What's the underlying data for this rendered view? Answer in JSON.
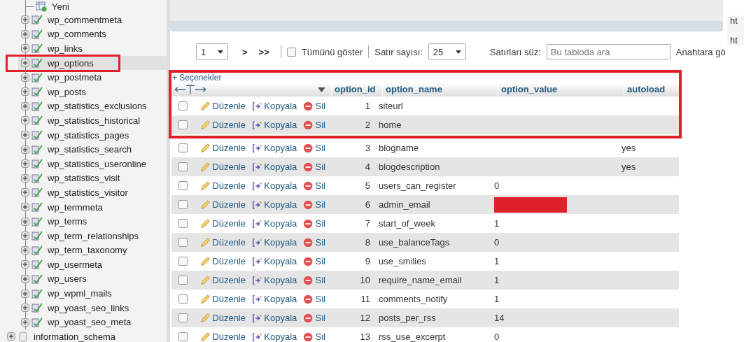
{
  "sidebar": {
    "new_item": {
      "label": "Yeni"
    },
    "items": [
      {
        "label": "wp_commentmeta",
        "selected": false,
        "framed": false
      },
      {
        "label": "wp_comments",
        "selected": false,
        "framed": false
      },
      {
        "label": "wp_links",
        "selected": false,
        "framed": false
      },
      {
        "label": "wp_options",
        "selected": true,
        "framed": true
      },
      {
        "label": "wp_postmeta",
        "selected": false,
        "framed": false
      },
      {
        "label": "wp_posts",
        "selected": false,
        "framed": false
      },
      {
        "label": "wp_statistics_exclusions",
        "selected": false,
        "framed": false
      },
      {
        "label": "wp_statistics_historical",
        "selected": false,
        "framed": false
      },
      {
        "label": "wp_statistics_pages",
        "selected": false,
        "framed": false
      },
      {
        "label": "wp_statistics_search",
        "selected": false,
        "framed": false
      },
      {
        "label": "wp_statistics_useronline",
        "selected": false,
        "framed": false
      },
      {
        "label": "wp_statistics_visit",
        "selected": false,
        "framed": false
      },
      {
        "label": "wp_statistics_visitor",
        "selected": false,
        "framed": false
      },
      {
        "label": "wp_termmeta",
        "selected": false,
        "framed": false
      },
      {
        "label": "wp_terms",
        "selected": false,
        "framed": false
      },
      {
        "label": "wp_term_relationships",
        "selected": false,
        "framed": false
      },
      {
        "label": "wp_term_taxonomy",
        "selected": false,
        "framed": false
      },
      {
        "label": "wp_usermeta",
        "selected": false,
        "framed": false
      },
      {
        "label": "wp_users",
        "selected": false,
        "framed": false
      },
      {
        "label": "wp_wpml_mails",
        "selected": false,
        "framed": false
      },
      {
        "label": "wp_yoast_seo_links",
        "selected": false,
        "framed": false
      },
      {
        "label": "wp_yoast_seo_meta",
        "selected": false,
        "framed": false
      }
    ],
    "database": {
      "label": "information_schema"
    }
  },
  "side_texts": [
    "ht",
    "ht"
  ],
  "navigation": {
    "page": "1",
    "next": ">",
    "last": ">>",
    "show_all": {
      "label": "Tümünü göster",
      "checked": false
    },
    "rows_label": "Satır sayısı:",
    "rows": "25",
    "filter_label": "Satırları süz:",
    "filter_placeholder": "Bu tabloda ara",
    "key_label": "Anahtara gö"
  },
  "table": {
    "options_link": "+ Seçenekler",
    "framed": true,
    "columns": [
      "option_id",
      "option_name",
      "option_value",
      "autoload"
    ],
    "rows": [
      {
        "edit": "Düzenle",
        "copy": "Kopyala",
        "delete": "Sil",
        "id": "1",
        "name": "siteurl",
        "checked": false,
        "redacted": false
      },
      {
        "edit": "Düzenle",
        "copy": "Kopyala",
        "delete": "Sil",
        "id": "2",
        "name": "home",
        "checked": false,
        "redacted": false
      },
      {
        "edit": "Düzenle",
        "copy": "Kopyala",
        "delete": "Sil",
        "id": "3",
        "name": "blogname",
        "autoload": "yes",
        "checked": false,
        "redacted": false
      },
      {
        "edit": "Düzenle",
        "copy": "Kopyala",
        "delete": "Sil",
        "id": "4",
        "name": "blogdescription",
        "autoload": "yes",
        "checked": false,
        "redacted": false
      },
      {
        "edit": "Düzenle",
        "copy": "Kopyala",
        "delete": "Sil",
        "id": "5",
        "name": "users_can_register",
        "value": "0",
        "checked": false,
        "redacted": false
      },
      {
        "edit": "Düzenle",
        "copy": "Kopyala",
        "delete": "Sil",
        "id": "6",
        "name": "admin_email",
        "checked": false,
        "redacted": true
      },
      {
        "edit": "Düzenle",
        "copy": "Kopyala",
        "delete": "Sil",
        "id": "7",
        "name": "start_of_week",
        "value": "1",
        "checked": false,
        "redacted": false
      },
      {
        "edit": "Düzenle",
        "copy": "Kopyala",
        "delete": "Sil",
        "id": "8",
        "name": "use_balanceTags",
        "value": "0",
        "checked": false,
        "redacted": false
      },
      {
        "edit": "Düzenle",
        "copy": "Kopyala",
        "delete": "Sil",
        "id": "9",
        "name": "use_smilies",
        "value": "1",
        "checked": false,
        "redacted": false
      },
      {
        "edit": "Düzenle",
        "copy": "Kopyala",
        "delete": "Sil",
        "id": "10",
        "name": "require_name_email",
        "value": "1",
        "checked": false,
        "redacted": false
      },
      {
        "edit": "Düzenle",
        "copy": "Kopyala",
        "delete": "Sil",
        "id": "11",
        "name": "comments_notify",
        "value": "1",
        "checked": false,
        "redacted": false
      },
      {
        "edit": "Düzenle",
        "copy": "Kopyala",
        "delete": "Sil",
        "id": "12",
        "name": "posts_per_rss",
        "value": "14",
        "checked": false,
        "redacted": false
      },
      {
        "edit": "Düzenle",
        "copy": "Kopyala",
        "delete": "Sil",
        "id": "13",
        "name": "rss_use_excerpt",
        "value": "0",
        "checked": false,
        "redacted": false
      }
    ]
  }
}
